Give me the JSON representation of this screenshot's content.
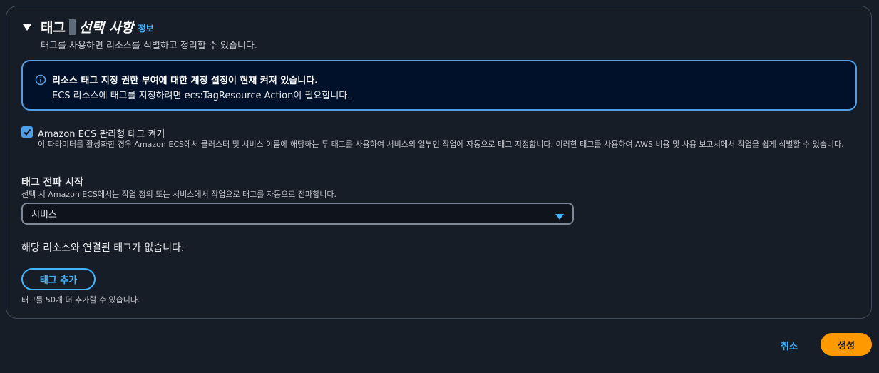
{
  "section": {
    "title": "태그",
    "title_italic": "선택 사항",
    "info_link": "정보",
    "description": "태그를 사용하면 리소스를 식별하고 정리할 수 있습니다."
  },
  "alert": {
    "title": "리소스 태그 지정 권한 부여에 대한 계정 설정이 현재 켜져 있습니다.",
    "body": "ECS 리소스에 태그를 지정하려면 ecs:TagResource Action이 필요합니다."
  },
  "managed_tags": {
    "checked": true,
    "label": "Amazon ECS 관리형 태그 켜기",
    "description": "이 파라미터를 활성화한 경우 Amazon ECS에서 클러스터 및 서비스 이름에 해당하는 두 태그를 사용하여 서비스의 일부인 작업에 자동으로 태그 지정합니다. 이러한 태그를 사용하여 AWS 비용 및 사용 보고서에서 작업을 쉽게 식별할 수 있습니다."
  },
  "propagate": {
    "label": "태그 전파 시작",
    "description": "선택 시 Amazon ECS에서는 작업 정의 또는 서비스에서 작업으로 태그를 자동으로 전파합니다.",
    "selected_value": "서비스"
  },
  "tags": {
    "empty_message": "해당 리소스와 연결된 태그가 없습니다.",
    "add_button": "태그 추가",
    "hint": "태그를 50개 더 추가할 수 있습니다."
  },
  "footer": {
    "cancel": "취소",
    "create": "생성"
  },
  "colors": {
    "accent": "#42b4ff",
    "primary": "#ff9900",
    "background": "#161d26"
  }
}
